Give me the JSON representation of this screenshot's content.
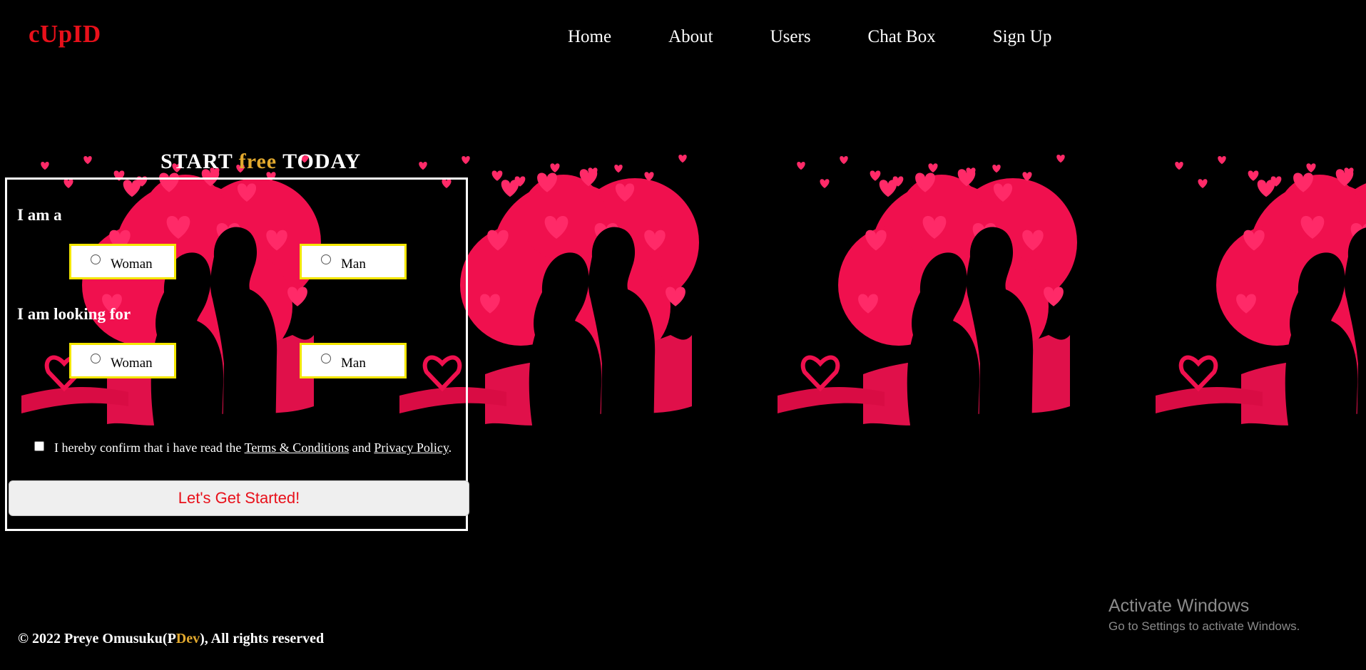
{
  "brand": "cUpID",
  "nav": [
    "Home",
    "About",
    "Users",
    "Chat Box",
    "Sign Up"
  ],
  "form": {
    "title_start": "START",
    "title_free": "free",
    "title_end": "TODAY",
    "i_am_label": "I am a",
    "looking_for_label": "I am looking for",
    "options": [
      "Woman",
      "Man"
    ],
    "confirm_prefix": "I hereby confirm that i have read the",
    "terms_link": "Terms & Conditions",
    "and_text": "and",
    "privacy_link": "Privacy Policy",
    "period": ".",
    "submit_label": "Let's Get Started!"
  },
  "footer": {
    "pre": "© 2022 Preye Omusuku(P",
    "dev": "Dev",
    "post": "), All rights reserved"
  },
  "watermark": {
    "title": "Activate Windows",
    "subtitle": "Go to Settings to activate Windows."
  },
  "colors": {
    "brand": "#e8101a",
    "accent": "#e2a92e",
    "heart": "#f0104e",
    "option_border": "#f3e600"
  }
}
